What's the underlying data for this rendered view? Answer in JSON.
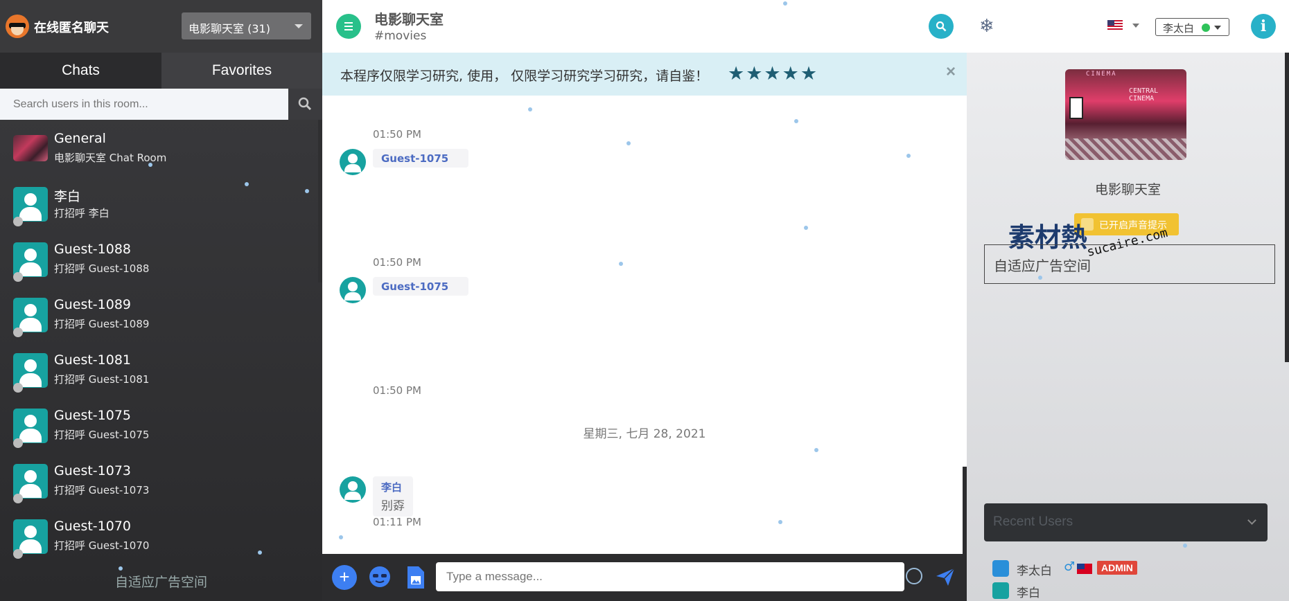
{
  "brand": {
    "name": "在线匿名聊天"
  },
  "room_selector": {
    "label": "电影聊天室 (31)"
  },
  "tabs": [
    {
      "label": "Chats"
    },
    {
      "label": "Favorites"
    }
  ],
  "search": {
    "placeholder": "Search users in this room..."
  },
  "user_list": [
    {
      "name": "General",
      "sub": "电影聊天室 Chat Room"
    },
    {
      "name": "李白",
      "sub": "打招呼 李白"
    },
    {
      "name": "Guest-1088",
      "sub": "打招呼 Guest-1088"
    },
    {
      "name": "Guest-1089",
      "sub": "打招呼 Guest-1089"
    },
    {
      "name": "Guest-1081",
      "sub": "打招呼 Guest-1081"
    },
    {
      "name": "Guest-1075",
      "sub": "打招呼 Guest-1075"
    },
    {
      "name": "Guest-1073",
      "sub": "打招呼 Guest-1073"
    },
    {
      "name": "Guest-1070",
      "sub": "打招呼 Guest-1070"
    }
  ],
  "sidebar_ad": "自适应广告空间",
  "header": {
    "title": "电影聊天室",
    "tag": "#movies"
  },
  "notice": {
    "text": "本程序仅限学习研究, 使用， 仅限学习研究学习研究，请自鉴！",
    "stars": "★★★★★",
    "close": "×"
  },
  "messages": [
    {
      "time": "01:50 PM",
      "user": "Guest-1075",
      "text": ""
    },
    {
      "time": "01:50 PM",
      "user": "Guest-1075",
      "text": ""
    },
    {
      "time": "01:50 PM",
      "user": "",
      "text": ""
    },
    {
      "time": "01:11 PM",
      "user": "李白",
      "text": "别孬"
    }
  ],
  "date_separator": "星期三, 七月 28, 2021",
  "composer": {
    "placeholder": "Type a message..."
  },
  "topbar_right": {
    "user_name": "李太白",
    "info": "i",
    "snow": "❄"
  },
  "room_panel": {
    "name": "电影聊天室",
    "sound_badge": "已开启声音提示",
    "image_sign": "CINEMA",
    "image_neon": "CENTRAL CINEMA",
    "ad": "自适应广告空间",
    "watermark_logo": "素材熱",
    "watermark_url": "sucaire.com"
  },
  "recent_users": {
    "title": "Recent Users",
    "items": [
      {
        "name": "李太白",
        "gender": "♂",
        "role": "ADMIN"
      },
      {
        "name": "李白"
      }
    ]
  },
  "colors": {
    "accent_green": "#28c08a",
    "accent_cyan": "#28b1c8",
    "sidebar_dark": "#2b2b2d",
    "link_blue": "#4c6bc2",
    "admin_red": "#e0463a"
  }
}
